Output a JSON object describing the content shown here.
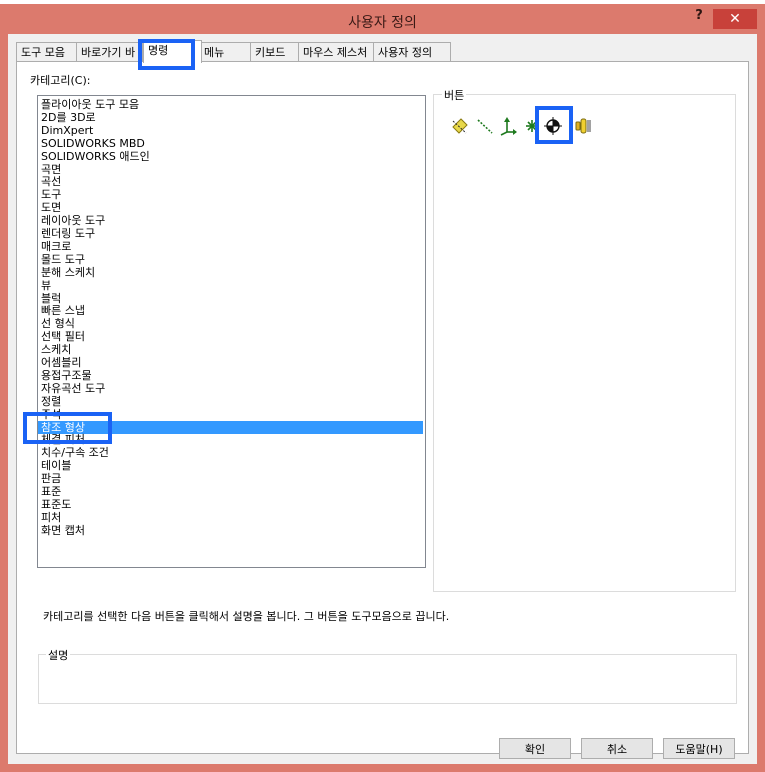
{
  "window": {
    "title": "사용자 정의",
    "help_glyph": "?",
    "close_glyph": "✕"
  },
  "tabs": [
    {
      "label": "도구 모음"
    },
    {
      "label": "바로가기 바"
    },
    {
      "label": "명령"
    },
    {
      "label": "메뉴"
    },
    {
      "label": "키보드"
    },
    {
      "label": "마우스 제스처"
    },
    {
      "label": "사용자 정의"
    }
  ],
  "active_tab": "명령",
  "categories": {
    "label": "카테고리(C):",
    "items": [
      "플라이아웃 도구 모음",
      "2D를 3D로",
      "DimXpert",
      "SOLIDWORKS MBD",
      "SOLIDWORKS 애드인",
      "곡면",
      "곡선",
      "도구",
      "도면",
      "레이아웃 도구",
      "렌더링 도구",
      "매크로",
      "몰드 도구",
      "분해 스케치",
      "뷰",
      "블럭",
      "빠른 스냅",
      "선 형식",
      "선택 필터",
      "스케치",
      "어셈블리",
      "용접구조물",
      "자유곡선 도구",
      "정렬",
      "주석",
      "참조 형상",
      "체결 피처",
      "치수/구속 조건",
      "테이블",
      "판금",
      "표준",
      "표준도",
      "피처",
      "화면 캡처"
    ],
    "selected": "참조 형상"
  },
  "buttons_group": {
    "label": "버튼",
    "icons": [
      "plane-icon",
      "axis-icon",
      "coordinate-system-icon",
      "point-icon",
      "center-of-mass-icon",
      "mate-reference-icon"
    ]
  },
  "description": {
    "instruction": "카테고리를 선택한 다음 버튼을 클릭해서 설명을 봅니다. 그 버튼을 도구모음으로 끕니다.",
    "label": "설명"
  },
  "footer": {
    "ok": "확인",
    "cancel": "취소",
    "help": "도움말(H)"
  },
  "colors": {
    "title_bar": "#dc7a6d",
    "close_button": "#c8413a",
    "selection": "#3399ff",
    "highlight": "#1a62f5"
  }
}
